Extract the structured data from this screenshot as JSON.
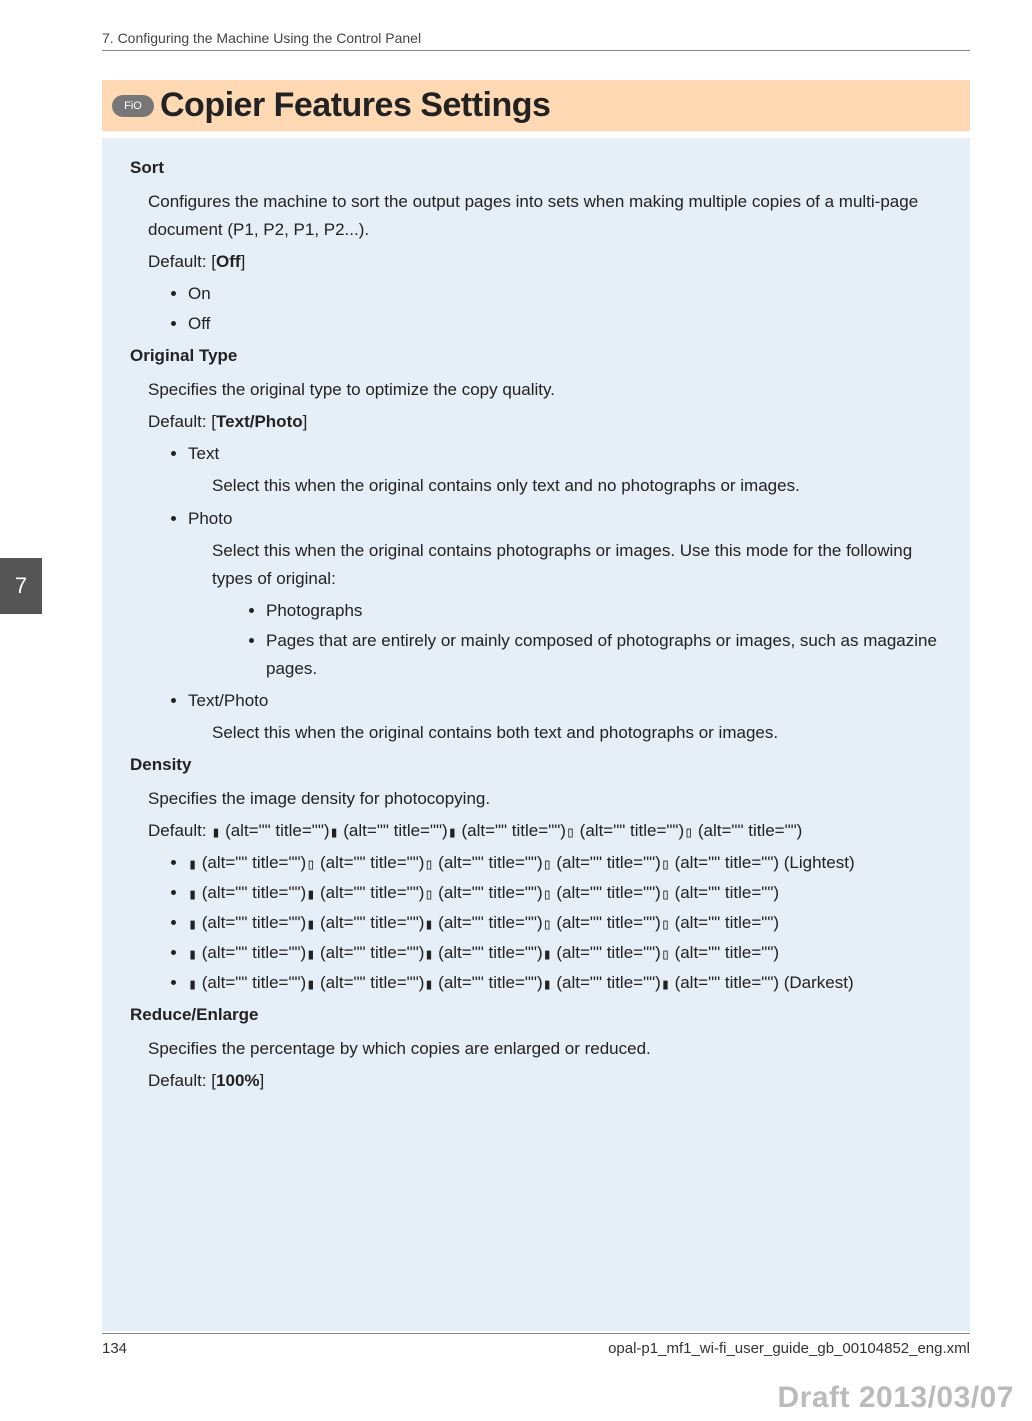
{
  "header": {
    "chapter": "7. Configuring the Machine Using the Control Panel"
  },
  "title": {
    "badge": "FiO",
    "text": "Copier Features Settings"
  },
  "side_tab": "7",
  "glyph_alt_segment": " (alt=\"\" title=\"\")",
  "glyph_filled": "▮",
  "glyph_empty": "▯",
  "sections": {
    "sort": {
      "title": "Sort",
      "desc": "Configures the machine to sort the output pages into sets when making multiple copies of a multi-page document (P1, P2, P1, P2...).",
      "default_label": "Default: [",
      "default_value": "Off",
      "default_close": "]",
      "options": [
        "On",
        "Off"
      ]
    },
    "original_type": {
      "title": "Original Type",
      "desc": "Specifies the original type to optimize the copy quality.",
      "default_label": "Default: [",
      "default_value": "Text/Photo",
      "default_close": "]",
      "items": [
        {
          "name": "Text",
          "desc": "Select this when the original contains only text and no photographs or images."
        },
        {
          "name": "Photo",
          "desc": "Select this when the original contains photographs or images. Use this mode for the following types of original:",
          "sub": [
            "Photographs",
            "Pages that are entirely or mainly composed of photographs or images, such as magazine pages."
          ]
        },
        {
          "name": "Text/Photo",
          "desc": "Select this when the original contains both text and photographs or images."
        }
      ]
    },
    "density": {
      "title": "Density",
      "desc": "Specifies the image density for photocopying.",
      "default_label": "Default: ",
      "default_pattern": [
        1,
        1,
        1,
        0,
        0
      ],
      "levels": [
        {
          "pattern": [
            1,
            0,
            0,
            0,
            0
          ],
          "suffix": " (Lightest)"
        },
        {
          "pattern": [
            1,
            1,
            0,
            0,
            0
          ],
          "suffix": ""
        },
        {
          "pattern": [
            1,
            1,
            1,
            0,
            0
          ],
          "suffix": ""
        },
        {
          "pattern": [
            1,
            1,
            1,
            1,
            0
          ],
          "suffix": ""
        },
        {
          "pattern": [
            1,
            1,
            1,
            1,
            1
          ],
          "suffix": " (Darkest)"
        }
      ]
    },
    "reduce_enlarge": {
      "title": "Reduce/Enlarge",
      "desc": "Specifies the percentage by which copies are enlarged or reduced.",
      "default_label": "Default: [",
      "default_value": "100%",
      "default_close": "]"
    }
  },
  "footer": {
    "page": "134",
    "file": "opal-p1_mf1_wi-fi_user_guide_gb_00104852_eng.xml"
  },
  "draft": "Draft 2013/03/07"
}
